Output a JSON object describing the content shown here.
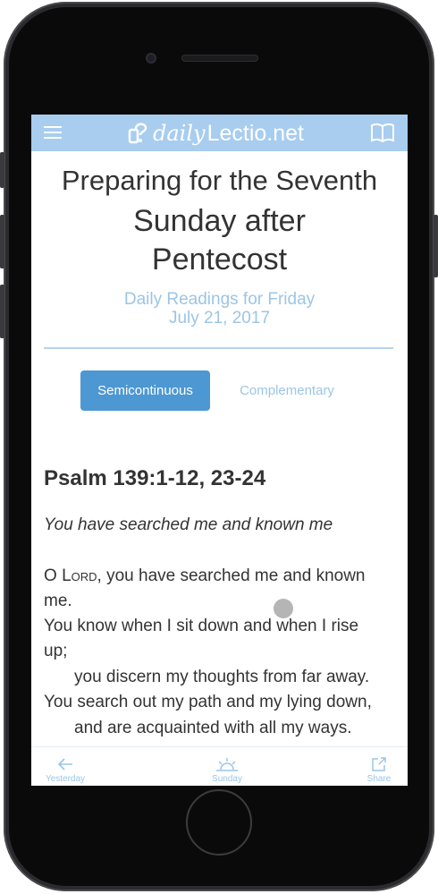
{
  "header": {
    "logo_daily": "daily",
    "logo_rest": "Lectio.net"
  },
  "title": {
    "line1": "Preparing for the Seventh",
    "line2": "Sunday after",
    "line3": "Pentecost"
  },
  "subtitle": {
    "line1": "Daily Readings for Friday",
    "line2": "July 21, 2017"
  },
  "tabs": [
    {
      "label": "Semicontinuous",
      "active": true
    },
    {
      "label": "Complementary",
      "active": false
    }
  ],
  "reading": {
    "reference": "Psalm 139:1-12, 23-24",
    "subtitle": "You have searched me and known me",
    "lines": {
      "l1_prefix": "O ",
      "l1_lord": "Lord",
      "l1_rest": ", you have searched me and known",
      "l2": "me.",
      "l3": "You know when I sit down and when I rise",
      "l4": "up;",
      "l5": "you discern my thoughts from far away.",
      "l6": "You search out my path and my lying down,",
      "l7": "and are acquainted with all my ways."
    }
  },
  "bottom_nav": [
    {
      "label": "Yesterday",
      "icon": "arrow-left-icon"
    },
    {
      "label": "Sunday",
      "icon": "sunrise-icon"
    },
    {
      "label": "Share",
      "icon": "share-icon"
    }
  ],
  "colors": {
    "header_bg": "#a8cdef",
    "accent": "#4d97d2",
    "light_accent": "#9cc5e6"
  }
}
